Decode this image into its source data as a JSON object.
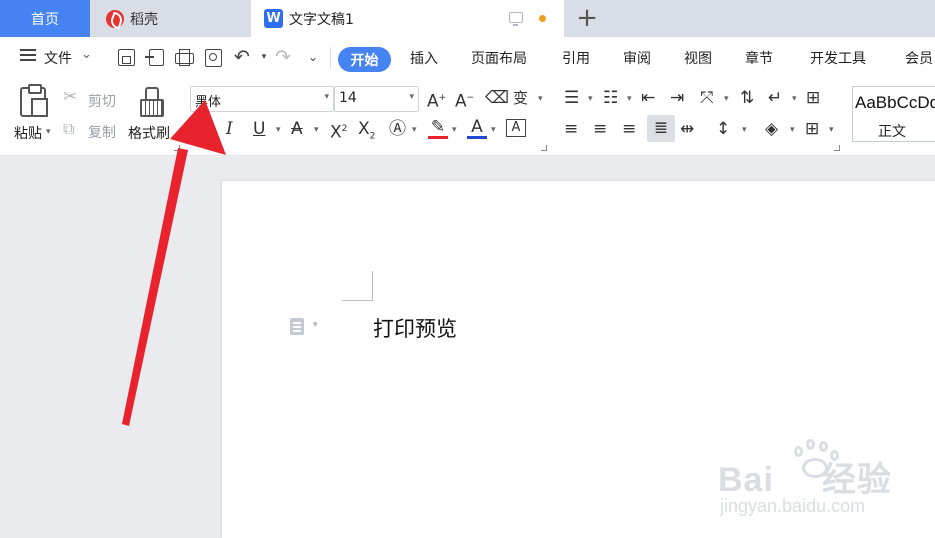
{
  "tabs": {
    "home": "首页",
    "daoke": "稻壳",
    "document": "文字文稿1",
    "add": "+"
  },
  "menubar": {
    "file": "文件",
    "tabs": [
      "开始",
      "插入",
      "页面布局",
      "引用",
      "审阅",
      "视图",
      "章节",
      "开发工具",
      "会员"
    ]
  },
  "ribbon": {
    "paste": "粘贴",
    "cut": "剪切",
    "copy": "复制",
    "format_painter": "格式刷",
    "font_name": "黑体",
    "font_size": "14",
    "style_preview": "AaBbCcDd",
    "style_name": "正文"
  },
  "document": {
    "text": "打印预览"
  },
  "watermark": {
    "brand": "Bai",
    "brand_cn": "经验",
    "url": "jingyan.baidu.com"
  },
  "colors": {
    "accent": "#4583f2",
    "annotation_arrow": "#e8232d",
    "highlight_red": "#e8232d",
    "font_color_blue": "#2248d8"
  }
}
